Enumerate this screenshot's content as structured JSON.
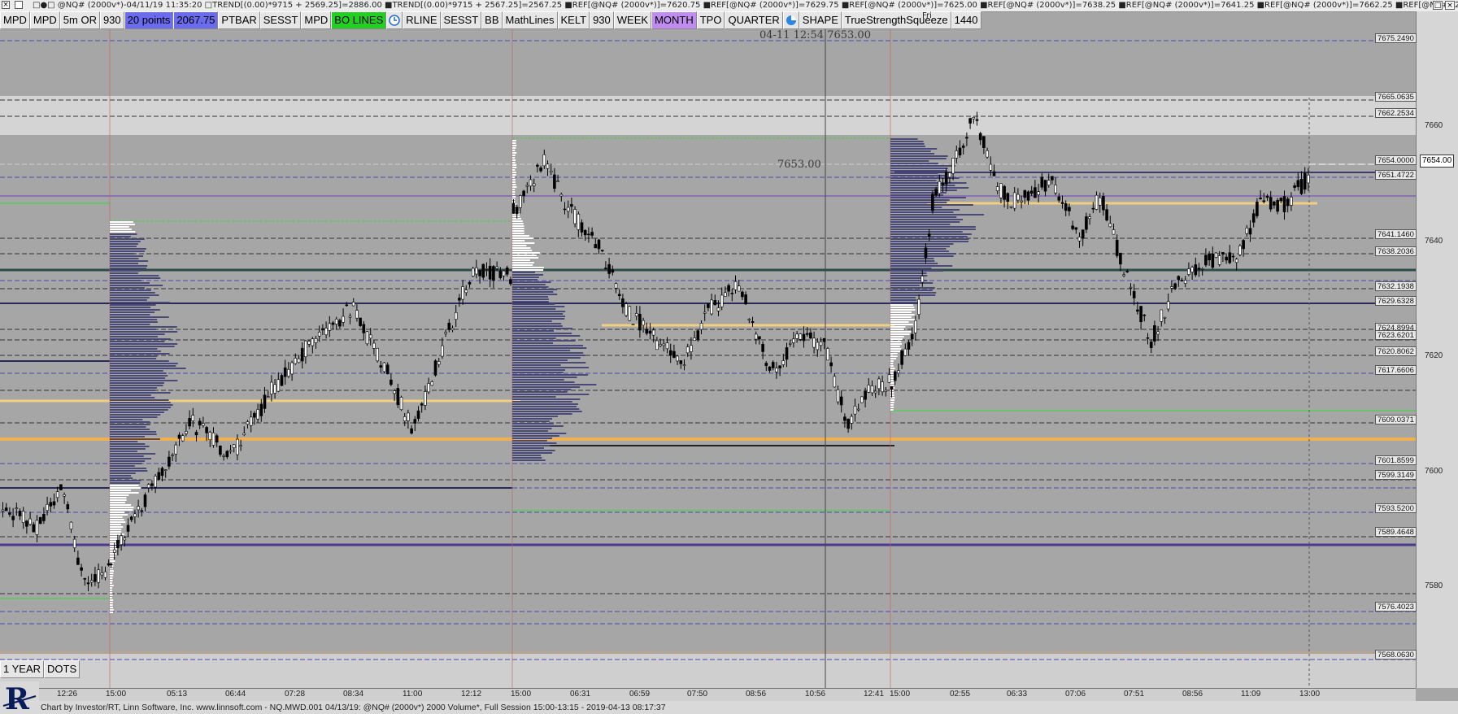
{
  "window": {
    "title": "□●□ @NQ# (2000v*)-04/11/19 11:35:20 □TREND[(0.00)*9715 + 2569.25]=2886.00 ■TREND[(0.00)*9715 + 2567.25]=2567.25 ■REF[@NQ# (2000v*)]=7620.75 ■REF[@NQ# (2000v*)]=7629.75 ■REF[@NQ# (2000v*)]=7625.00 ■REF[@NQ# (2000v*)]=7638.25 ■REF[@NQ# (2000v*)]=7641.25 ■REF[@NQ# (2000v*)]=7662.25 ■REF[@NQ# (2000v*)]=7..."
  },
  "toolbar": {
    "buttons": [
      {
        "label": "MPD",
        "bg": "#e6e6e6"
      },
      {
        "label": "MPD",
        "bg": "#e6e6e6"
      },
      {
        "label": "5m OR",
        "bg": "#e6e6e6"
      },
      {
        "label": "930",
        "bg": "#e6e6e6"
      },
      {
        "label": "20 points",
        "bg": "#6b6bf0"
      },
      {
        "label": "2067.75",
        "bg": "#6b6bf0"
      },
      {
        "label": "PTBAR",
        "bg": "#e6e6e6"
      },
      {
        "label": "SESST",
        "bg": "#e6e6e6"
      },
      {
        "label": "MPD",
        "bg": "#e6e6e6"
      },
      {
        "label": "BO LINES",
        "bg": "#22d022"
      },
      {
        "label": "clock-icon",
        "bg": "#e6e6e6",
        "icon": true
      },
      {
        "label": "RLINE",
        "bg": "#e6e6e6"
      },
      {
        "label": "SESST",
        "bg": "#e6e6e6"
      },
      {
        "label": "BB",
        "bg": "#e6e6e6"
      },
      {
        "label": "MathLines",
        "bg": "#e6e6e6"
      },
      {
        "label": "KELT",
        "bg": "#e6e6e6"
      },
      {
        "label": "930",
        "bg": "#e6e6e6"
      },
      {
        "label": "WEEK",
        "bg": "#e6e6e6"
      },
      {
        "label": "MONTH",
        "bg": "#c08cf0"
      },
      {
        "label": "TPO",
        "bg": "#e6e6e6"
      },
      {
        "label": "QUARTER",
        "bg": "#e6e6e6"
      },
      {
        "label": "pie-icon",
        "bg": "#e6e6e6",
        "icon": true
      },
      {
        "label": "SHAPE",
        "bg": "#e6e6e6"
      },
      {
        "label": "TrueStrengthSqueeze",
        "bg": "#e6e6e6"
      },
      {
        "label": "1440",
        "bg": "#e6e6e6"
      }
    ]
  },
  "cursor_readout": "04-11 12:54 7653.00",
  "price_note": "7653.00",
  "day_label": "Fri",
  "price_axis": {
    "ticks": [
      "7660",
      "7640",
      "7620",
      "7600",
      "7580"
    ],
    "current_price": "7654.00",
    "levels": [
      "7675.2490",
      "7665.0635",
      "7662.2534",
      "7654.0000",
      "7651.4722",
      "7641.1460",
      "7638.2036",
      "7632.1938",
      "7629.6328",
      "7624.8994",
      "7623.6201",
      "7620.8062",
      "7617.6606",
      "7609.0371",
      "7601.8599",
      "7599.3149",
      "7593.5200",
      "7589.4648",
      "7576.4023",
      "7568.0630"
    ]
  },
  "time_axis": {
    "labels": [
      "12:26",
      "15:00",
      "05:13",
      "06:44",
      "07:28",
      "08:34",
      "11:00",
      "12:12",
      "15:00",
      "06:31",
      "06:59",
      "07:50",
      "08:56",
      "10:56",
      "12:41",
      "15:00",
      "02:55",
      "06:33",
      "07:06",
      "07:51",
      "08:56",
      "11:09",
      "13:00"
    ]
  },
  "bottom_buttons": [
    "1 YEAR",
    "DOTS"
  ],
  "status": {
    "text": "Chart by Investor/RT, Linn Software, Inc. www.linnsoft.com - NQ.MWD.001  04/13/19: @NQ# (2000v*) 2000 Volume*, Full Session 15:00-13:15 - 2019-04-13 08:17:37"
  },
  "colors": {
    "background": "#a6a6a6",
    "upCandle": "#ffffff",
    "downCandle": "#000000",
    "profile": "#4a4a78",
    "vpocYellow": "#f0d080",
    "navyLine": "#2a2a5a",
    "greenLine": "#33dd33",
    "purpleLine": "#7040c0"
  }
}
